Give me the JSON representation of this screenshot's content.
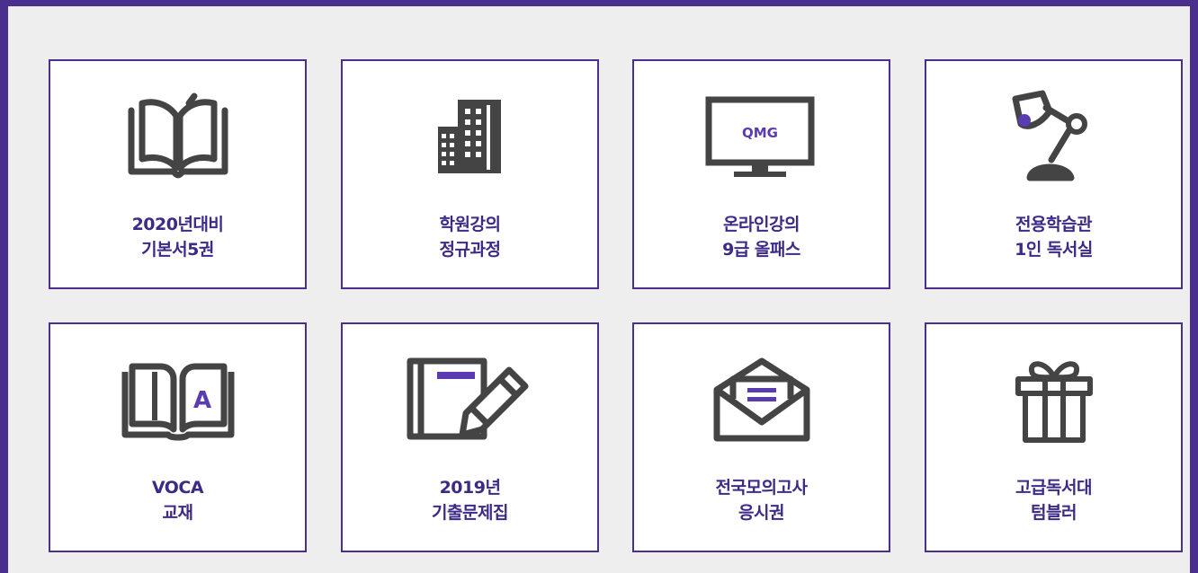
{
  "brand_colors": {
    "frame": "#4a2f8f",
    "icon_gray": "#444444",
    "accent": "#5b3bb0"
  },
  "cards": [
    {
      "line1": "2020년대비",
      "line2": "기본서5권",
      "icon": "open-book-icon"
    },
    {
      "line1": "학원강의",
      "line2": "정규과정",
      "icon": "building-icon"
    },
    {
      "line1": "온라인강의",
      "line2": "9급 올패스",
      "icon": "monitor-icon",
      "screen_text": "QMG"
    },
    {
      "line1": "전용학습관",
      "line2": "1인 독서실",
      "icon": "desk-lamp-icon"
    },
    {
      "line1": "VOCA",
      "line2": "교재",
      "icon": "vocab-book-icon",
      "book_letter": "A"
    },
    {
      "line1": "2019년",
      "line2": "기출문제집",
      "icon": "notebook-pencil-icon"
    },
    {
      "line1": "전국모의고사",
      "line2": "응시권",
      "icon": "envelope-icon"
    },
    {
      "line1": "고급독서대",
      "line2": "텀블러",
      "icon": "gift-icon"
    }
  ]
}
